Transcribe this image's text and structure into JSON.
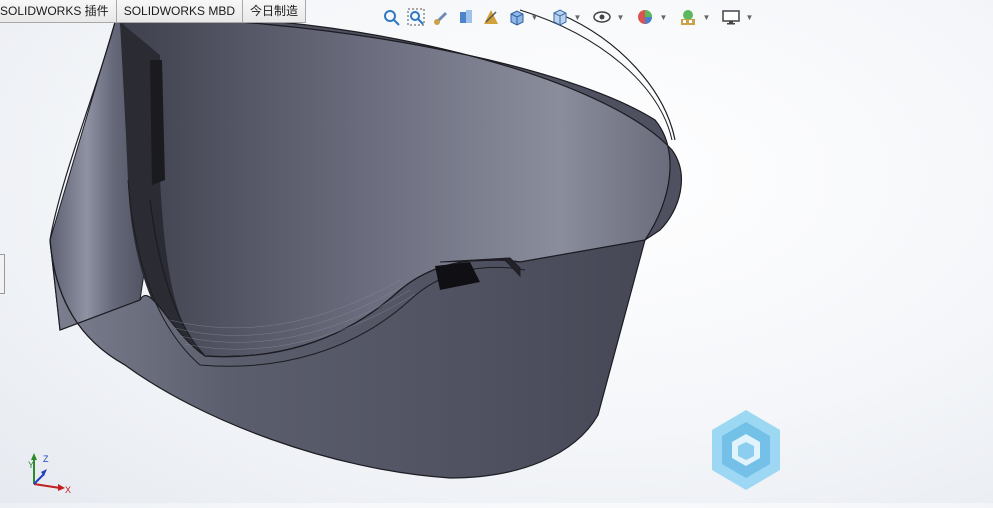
{
  "command_tabs": [
    {
      "label": "SOLIDWORKS 插件"
    },
    {
      "label": "SOLIDWORKS MBD"
    },
    {
      "label": "今日制造"
    }
  ],
  "heads_up_toolbar": {
    "tools": [
      "zoom-to-fit-icon",
      "zoom-to-area-icon",
      "previous-view-icon",
      "section-view-icon",
      "dynamic-annotation-icon",
      "view-orientation-icon",
      "display-style-icon",
      "hide-show-items-icon",
      "edit-appearance-icon",
      "apply-scene-icon",
      "view-settings-icon"
    ]
  },
  "triad_axes": {
    "x": "X",
    "y": "Y",
    "z": "Z"
  },
  "colors": {
    "part_body": "#575a6b",
    "part_inner": "#7f8194",
    "edge": "#1c1c22",
    "accent_blue": "#2f78c4",
    "watermark": "#7cc8ef"
  }
}
